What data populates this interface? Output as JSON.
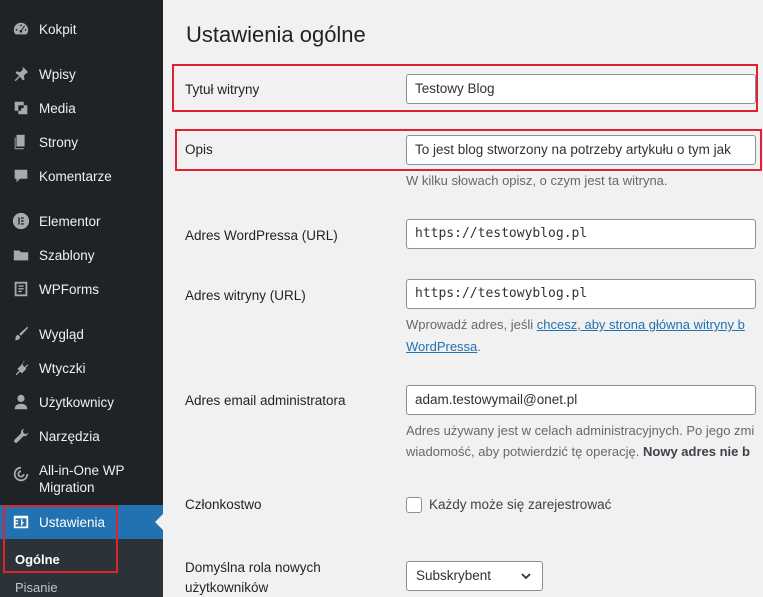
{
  "sidebar": {
    "items": [
      {
        "label": "Kokpit",
        "icon": "dashboard-icon"
      },
      {
        "label": "Wpisy",
        "icon": "pin-icon"
      },
      {
        "label": "Media",
        "icon": "media-icon"
      },
      {
        "label": "Strony",
        "icon": "pages-icon"
      },
      {
        "label": "Komentarze",
        "icon": "comment-icon"
      },
      {
        "label": "Elementor",
        "icon": "elementor-icon"
      },
      {
        "label": "Szablony",
        "icon": "folder-icon"
      },
      {
        "label": "WPForms",
        "icon": "forms-icon"
      },
      {
        "label": "Wygląd",
        "icon": "paintbrush-icon"
      },
      {
        "label": "Wtyczki",
        "icon": "plugin-icon"
      },
      {
        "label": "Użytkownicy",
        "icon": "users-icon"
      },
      {
        "label": "Narzędzia",
        "icon": "wrench-icon"
      },
      {
        "label1": "All-in-One WP",
        "label2": "Migration",
        "icon": "migration-icon"
      },
      {
        "label": "Ustawienia",
        "icon": "settings-icon"
      }
    ],
    "submenu": {
      "current": "Ogólne",
      "next": "Pisanie"
    }
  },
  "main": {
    "title": "Ustawienia ogólne",
    "site_title": {
      "label": "Tytuł witryny",
      "value": "Testowy Blog"
    },
    "tagline": {
      "label": "Opis",
      "value": "To jest blog stworzony na potrzeby artykułu o tym jak",
      "desc": "W kilku słowach opisz, o czym jest ta witryna."
    },
    "wp_url": {
      "label": "Adres WordPressa (URL)",
      "value": "https://testowyblog.pl"
    },
    "site_url": {
      "label": "Adres witryny (URL)",
      "value": "https://testowyblog.pl",
      "desc_prefix": "Wprowadź adres, jeśli ",
      "desc_link": "chcesz, aby strona główna witryny b",
      "desc_link2": "WordPressa",
      "desc_suffix": "."
    },
    "admin_email": {
      "label": "Adres email administratora",
      "value": "adam.testowymail@onet.pl",
      "desc1": "Adres używany jest w celach administracyjnych. Po jego zmi",
      "desc2_prefix": "wiadomość, aby potwierdzić tę operację. ",
      "desc2_bold": "Nowy adres nie b"
    },
    "membership": {
      "label": "Członkostwo",
      "checkbox_label": "Każdy może się zarejestrować"
    },
    "default_role": {
      "label1": "Domyślna rola nowych",
      "label2": "użytkowników",
      "value": "Subskrybent"
    }
  },
  "colors": {
    "sidebar_bg": "#1d2327",
    "active_bg": "#2271b1",
    "highlight": "#e0212f"
  }
}
